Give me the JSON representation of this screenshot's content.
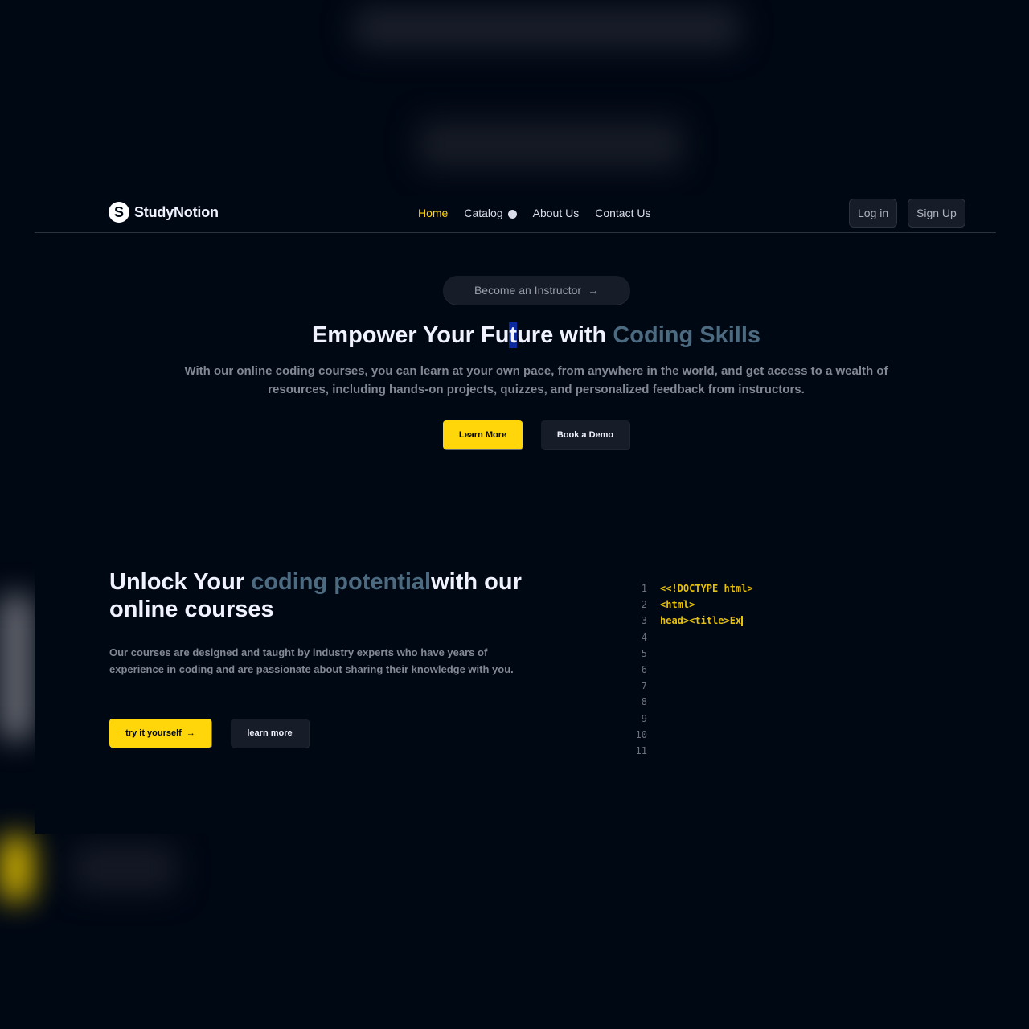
{
  "brand": {
    "logo_letter": "S",
    "name": "StudyNotion"
  },
  "nav": {
    "links": [
      {
        "label": "Home",
        "active": true
      },
      {
        "label": "Catalog",
        "dropdown": true
      },
      {
        "label": "About Us"
      },
      {
        "label": "Contact Us"
      }
    ],
    "login_label": "Log in",
    "signup_label": "Sign Up"
  },
  "hero": {
    "instructor_label": "Become an Instructor",
    "title_pre": "Empower Your Fu",
    "title_highlight": "t",
    "title_post": "ure with ",
    "title_accent": "Coding Skills",
    "subtitle": "With our online coding courses, you can learn at your own pace, from anywhere in the world, and get access to a wealth of resources, including hands-on projects, quizzes, and personalized feedback from instructors.",
    "learn_more_label": "Learn More",
    "book_demo_label": "Book a Demo"
  },
  "section2": {
    "title_pre": "Unlock Your ",
    "title_accent": "coding potential",
    "title_post": "with our online courses",
    "subtitle": "Our courses are designed and taught by industry experts who have years of experience in coding and are passionate about sharing their knowledge with you.",
    "try_label": "try it yourself",
    "learn_label": "learn more"
  },
  "code_block": {
    "line_numbers": [
      "1",
      "2",
      "3",
      "4",
      "5",
      "6",
      "7",
      "8",
      "9",
      "10",
      "11"
    ],
    "lines": [
      "<<!DOCTYPE html>",
      "<html>",
      "head><title>Ex"
    ]
  },
  "colors": {
    "accent": "#ffd60a",
    "background": "#000814",
    "accent_text": "#4c6a80",
    "code": "#e7c009"
  },
  "icons": {
    "arrow": "arrow-right-icon",
    "chevron": "chevron-down-icon"
  }
}
